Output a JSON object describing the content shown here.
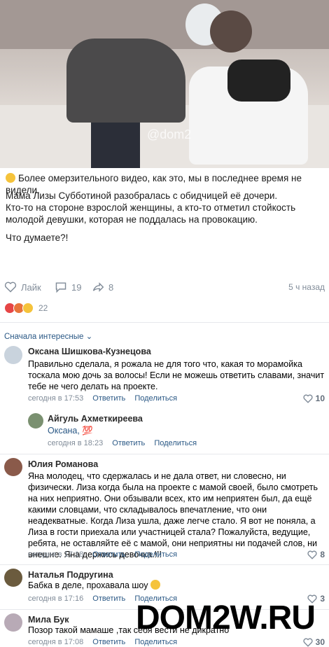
{
  "video": {
    "watermark": "@dom2"
  },
  "post": {
    "line1": "Более омерзительного видео, как это, мы в последнее время не видели.",
    "para1": "Мама Лизы Субботиной разобралась с обидчицей её дочери.",
    "para2": "Кто-то на стороне взрослой женщины, а кто-то отметил стойкость молодой девушки, которая не поддалась на провокацию.",
    "question": "Что думаете?!"
  },
  "actions": {
    "like_label": "Лайк",
    "comments": "19",
    "shares": "8",
    "time": "5 ч назад"
  },
  "reactions": {
    "count": "22"
  },
  "sort_label": "Сначала интересные",
  "comments": [
    {
      "name": "Оксана Шишкова-Кузнецова",
      "text": "Правильно сделала, я рожала не для того что, какая то морамойка тоскала мою дочь за волосы! Если не можешь ответить славами, значит тебе не чего делать на проекте.",
      "date": "сегодня в 17:53",
      "reply": "Ответить",
      "share": "Поделиться",
      "likes": "10"
    },
    {
      "name": "Айгуль Ахметкиреева",
      "mention": "Оксана,",
      "emoji": "💯",
      "date": "сегодня в 18:23",
      "reply": "Ответить",
      "share": "Поделиться"
    },
    {
      "name": "Юлия Романова",
      "text": "Яна молодец, что сдержалась и не дала ответ, ни словесно, ни физически. Лиза когда была на проекте с мамой своей, было смотреть на них неприятно. Они обзывали всех, кто им неприятен был, да ещё какими словцами, что складывалось впечатление, что они неадекватные. Когда Лиза ушла, даже легче стало. Я вот не поняла, а Лиза в гости приехала или участницей стала? Пожалуйста, ведущие, ребята, не оставляйте её с мамой, они неприятны ни подачей слов, ни внешне. Яна держись девочка.!!!",
      "date": "сегодня в 17:18",
      "reply": "Ответить",
      "share": "Поделиться",
      "likes": "8"
    },
    {
      "name": "Наталья Подругина",
      "text": "Бабка в деле, прохавала шоу",
      "date": "сегодня в 17:16",
      "reply": "Ответить",
      "share": "Поделиться",
      "likes": "3"
    },
    {
      "name": "Мила Бук",
      "text": "Позор такой мамаше ,так себя вести не дикратно",
      "date": "сегодня в 17:08",
      "reply": "Ответить",
      "share": "Поделиться",
      "likes": "30"
    }
  ],
  "site_watermark": "DOM2W.RU"
}
